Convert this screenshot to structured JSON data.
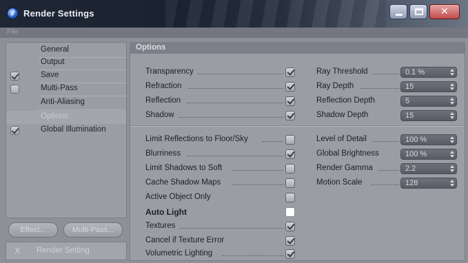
{
  "window": {
    "title": "Render Settings"
  },
  "menubar": {
    "file_label": "File"
  },
  "sidebar": {
    "items": [
      {
        "label": "General",
        "check": null,
        "selected": false
      },
      {
        "label": "Output",
        "check": null,
        "selected": false
      },
      {
        "label": "Save",
        "check": true,
        "selected": false
      },
      {
        "label": "Multi-Pass",
        "check": false,
        "selected": false
      },
      {
        "label": "Anti-Aliasing",
        "check": null,
        "selected": false
      },
      {
        "label": "Options",
        "check": null,
        "selected": true
      },
      {
        "label": "Global Illumination",
        "check": true,
        "selected": false
      }
    ],
    "effect_button": "Effect...",
    "multipass_button": "Multi-Pass...",
    "render_setting_label": "Render Setting",
    "close_glyph": "X"
  },
  "options": {
    "header": "Options",
    "left_checks": [
      {
        "label": "Transparency",
        "checked": true,
        "style": "normal"
      },
      {
        "label": "Refraction",
        "checked": true,
        "style": "normal"
      },
      {
        "label": "Reflection",
        "checked": true,
        "style": "normal"
      },
      {
        "label": "Shadow",
        "checked": true,
        "style": "normal"
      },
      {
        "label": "Limit Reflections to Floor/Sky",
        "checked": false,
        "style": "normal"
      },
      {
        "label": "Blurriness",
        "checked": true,
        "style": "normal"
      },
      {
        "label": "Limit Shadows to Soft",
        "checked": false,
        "style": "normal"
      },
      {
        "label": "Cache Shadow Maps",
        "checked": false,
        "style": "normal"
      },
      {
        "label": "Active Object Only",
        "checked": false,
        "style": "normal"
      },
      {
        "label": "Auto Light",
        "checked": false,
        "style": "bold-white"
      },
      {
        "label": "Textures",
        "checked": true,
        "style": "normal"
      },
      {
        "label": "Cancel if Texture Error",
        "checked": true,
        "style": "normal"
      },
      {
        "label": "Volumetric Lighting",
        "checked": true,
        "style": "normal"
      }
    ],
    "right_fields": [
      {
        "label": "Ray Threshold",
        "value": "0.1 %"
      },
      {
        "label": "Ray Depth",
        "value": "15"
      },
      {
        "label": "Reflection Depth",
        "value": "5"
      },
      {
        "label": "Shadow Depth",
        "value": "15"
      },
      {
        "label": "Level of Detail",
        "value": "100 %"
      },
      {
        "label": "Global Brightness",
        "value": "100 %"
      },
      {
        "label": "Render Gamma",
        "value": "2.2"
      },
      {
        "label": "Motion Scale",
        "value": "128"
      }
    ]
  },
  "colors": {
    "title_bar": "#1f2735",
    "panel": "#9a9da4",
    "field": "#5f626a",
    "close_button": "#c24b4b"
  }
}
